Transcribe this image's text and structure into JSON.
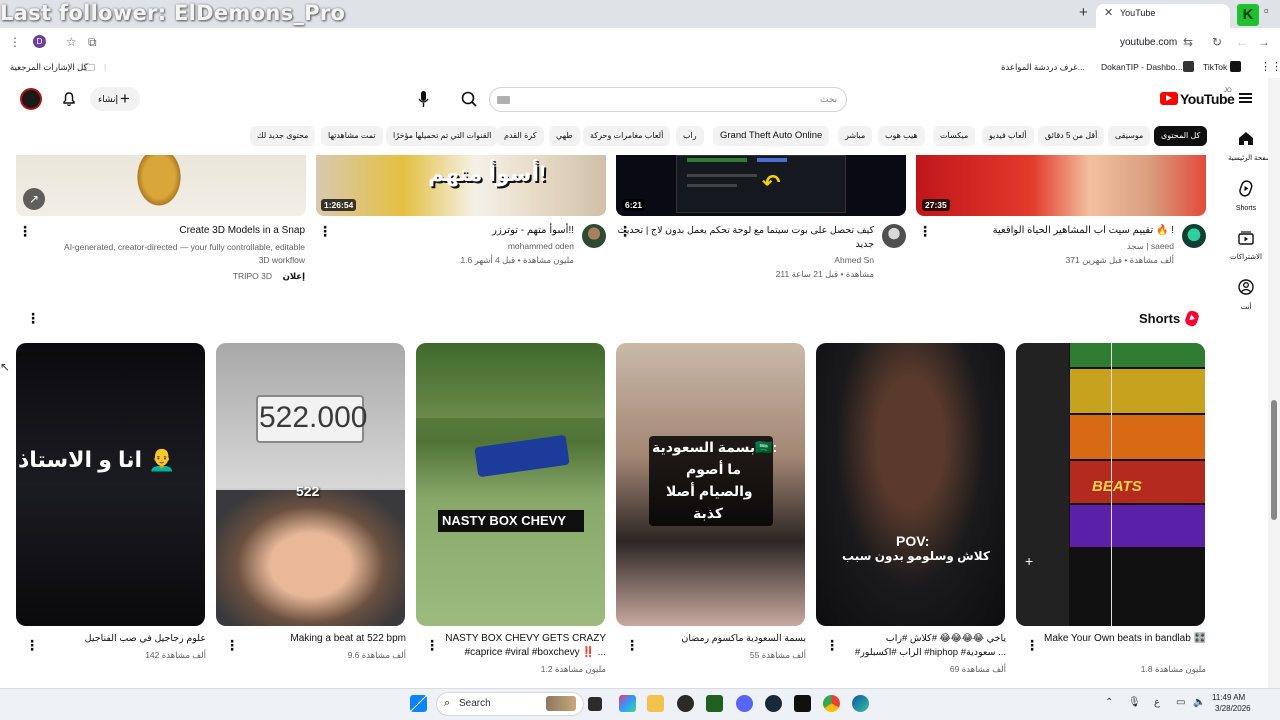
{
  "overlay": {
    "text": "Last follower: ElDemons_Pro"
  },
  "browser": {
    "tab_title": "YouTube",
    "url": "youtube.com",
    "profile_letter": "D",
    "bookmarks": [
      {
        "label": "TikTok",
        "icon": "tiktok-icon"
      },
      {
        "label": "DokanTIP - Dashbo...",
        "icon": "dokan-icon"
      },
      {
        "label": "غرف دردشة المواعدة...",
        "icon": "chat-rooms-icon"
      },
      {
        "label": "كل الإشارات المرجعية",
        "icon": "folder-icon"
      }
    ]
  },
  "youtube": {
    "logo_text": "YouTube",
    "logo_region": "JO",
    "search_placeholder": "بحث",
    "create_label": "إنشاء",
    "chips": [
      {
        "label": "كل المحتوى",
        "active": true
      },
      {
        "label": "موسيقى"
      },
      {
        "label": "أقل من 5 دقائق"
      },
      {
        "label": "ألعاب فيديو"
      },
      {
        "label": "ميكسات"
      },
      {
        "label": "هيب هوب"
      },
      {
        "label": "مباشر"
      },
      {
        "label": "Grand Theft Auto Online"
      },
      {
        "label": "راب"
      },
      {
        "label": "ألعاب مغامرات وحركة"
      },
      {
        "label": "طهي"
      },
      {
        "label": "كرة القدم"
      },
      {
        "label": "القنوات التي تم تحميلها مؤخرًا"
      },
      {
        "label": "تمت مشاهدتها"
      },
      {
        "label": "محتوى جديد لك"
      }
    ],
    "side_nav": [
      {
        "label": "الصفحة الرئيسية",
        "icon": "home-icon"
      },
      {
        "label": "Shorts",
        "icon": "shorts-icon"
      },
      {
        "label": "الاشتراكات",
        "icon": "subscriptions-icon"
      },
      {
        "label": "أنت",
        "icon": "you-icon"
      }
    ],
    "videos": [
      {
        "title": "تقييم سيت اب المشاهير الحياة الواقعية 🔥 !",
        "channel": "سجد | saeed",
        "meta": "371 ألف مشاهدة • قبل شهرين",
        "duration": "27:35"
      },
      {
        "title": "كيف تحصل على بوت سيتما مع لوحة تحكم يعمل بدون لاج | تحديث",
        "title2": "جديد",
        "channel": "Ahmed Sn",
        "meta": "211 مشاهدة • قبل 21 ساعة",
        "duration": "6:21"
      },
      {
        "title": "أسوأ متهم - توترزر!!",
        "channel": "mohammed oden",
        "meta": "1.6 مليون مشاهدة • قبل 4 أشهر",
        "duration": "1:26:54",
        "thumb_text": "أسوأ متهم!"
      },
      {
        "title": "Create 3D Models in a Snap",
        "desc1": "AI-generated, creator-directed — your fully controllable, editable",
        "desc2": "3D workflow",
        "ad_label": "إعلان",
        "channel": "TRIPO 3D"
      }
    ],
    "shorts_title": "Shorts",
    "shorts": [
      {
        "title": "Make Your Own beats in bandlab 🎛️",
        "views": "1.8 مليون مشاهدة",
        "overlay": "BEATS"
      },
      {
        "title": "ياخي 😂😂😂😂 #كلاش #راب",
        "title2": "#الراب #اكسبلور #hiphop #سعودية ...",
        "views": "69 ألف مشاهدة",
        "overlay": "POV:",
        "overlay2": "كلاش وسلومو بدون سبب"
      },
      {
        "title": "بسمة السعودية ماكسوم رمضان",
        "views": "55 ألف مشاهدة",
        "overlay": "بسمة السعودية🇸🇦:",
        "overlay2": "ما أصوم",
        "overlay3": "والصيام أصلا",
        "overlay4": "كذبة"
      },
      {
        "title": "NASTY BOX CHEVY GETS CRAZY",
        "title2": "#caprice #viral #boxchevy ‼️ ...",
        "views": "1.2 مليون مشاهدة",
        "overlay": "NASTY BOX CHEVY"
      },
      {
        "title": "Making a beat at 522 bpm",
        "views": "9.6 ألف مشاهدة",
        "overlay": "522.000",
        "overlay2": "522"
      },
      {
        "title": "علوم رجاجيل في صب الفناجيل",
        "views": "142 ألف مشاهدة",
        "overlay": "انا و الاستاذ 👨‍🦲"
      }
    ]
  },
  "taskbar": {
    "search_label": "Search",
    "time": "11:49 AM",
    "date": "3/28/2026",
    "lang": "ع"
  }
}
